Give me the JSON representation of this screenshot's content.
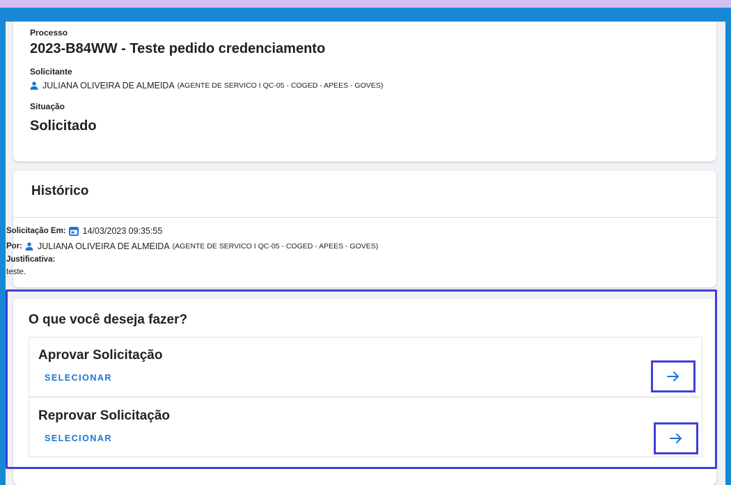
{
  "processo": {
    "label": "Processo",
    "value": "2023-B84WW - Teste pedido credenciamento",
    "solicitante_label": "Solicitante",
    "solicitante_name": "JULIANA OLIVEIRA DE ALMEIDA",
    "solicitante_dept": "(AGENTE DE SERVICO I QC-05 - COGED - APEES - GOVES)",
    "situacao_label": "Situação",
    "situacao_value": "Solicitado"
  },
  "historico": {
    "title": "Histórico",
    "solicitacao_label": "Solicitação Em:",
    "solicitacao_datetime": "14/03/2023 09:35:55",
    "por_label": "Por:",
    "por_name": "JULIANA OLIVEIRA DE ALMEIDA",
    "por_dept": "(AGENTE DE SERVICO I QC-05 - COGED - APEES - GOVES)",
    "justificativa_label": "Justificativa:",
    "justificativa_text": "teste."
  },
  "acoes": {
    "title": "O que você deseja fazer?",
    "options": [
      {
        "title": "Aprovar Solicitação",
        "action": "SELECIONAR"
      },
      {
        "title": "Reprovar Solicitação",
        "action": "SELECIONAR"
      }
    ]
  },
  "colors": {
    "frame": "#1888d6",
    "outer": "#d2c0f5",
    "highlight": "#3e3fd8",
    "link": "#1976d2"
  },
  "icons": {
    "person": "person-icon",
    "calendar": "calendar-icon",
    "arrow": "arrow-right-icon"
  }
}
